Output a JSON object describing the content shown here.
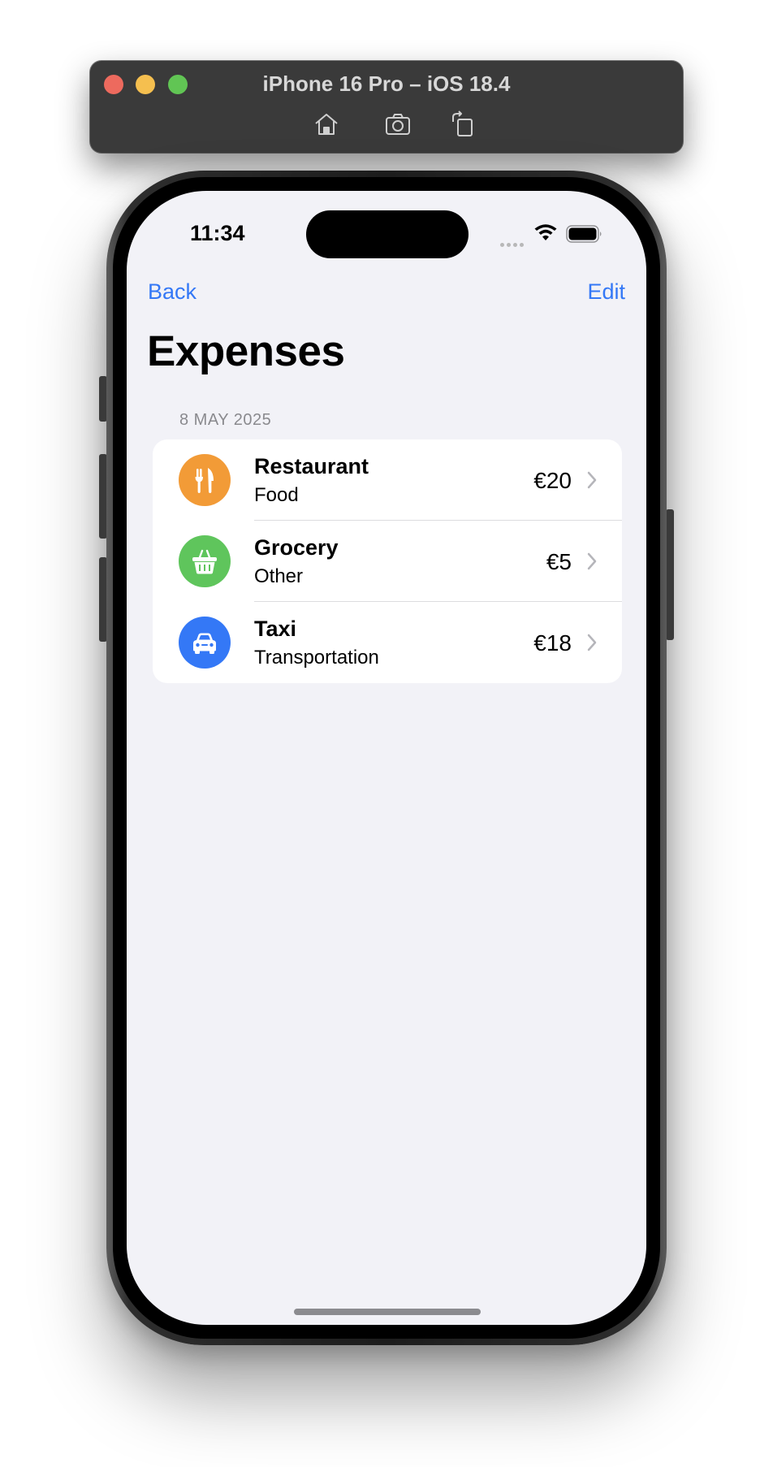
{
  "simulator": {
    "title": "iPhone 16 Pro – iOS 18.4",
    "tools": [
      {
        "icon": "home-icon"
      },
      {
        "icon": "screenshot-icon"
      },
      {
        "icon": "rotate-icon"
      }
    ]
  },
  "status_bar": {
    "time": "11:34",
    "icons": [
      "cellular-signal-icon",
      "wifi-icon",
      "battery-icon"
    ]
  },
  "nav": {
    "back_label": "Back",
    "edit_label": "Edit",
    "title": "Expenses"
  },
  "section": {
    "header": "8 MAY 2025",
    "items": [
      {
        "title": "Restaurant",
        "category": "Food",
        "amount": "€20",
        "icon": "fork-knife-icon",
        "color": "#f29b37"
      },
      {
        "title": "Grocery",
        "category": "Other",
        "amount": "€5",
        "icon": "basket-icon",
        "color": "#5fc55c"
      },
      {
        "title": "Taxi",
        "category": "Transportation",
        "amount": "€18",
        "icon": "car-icon",
        "color": "#3478f6"
      }
    ]
  },
  "colors": {
    "accent": "#3478f6",
    "background": "#f2f2f7",
    "secondary_text": "#8a8a8e"
  }
}
